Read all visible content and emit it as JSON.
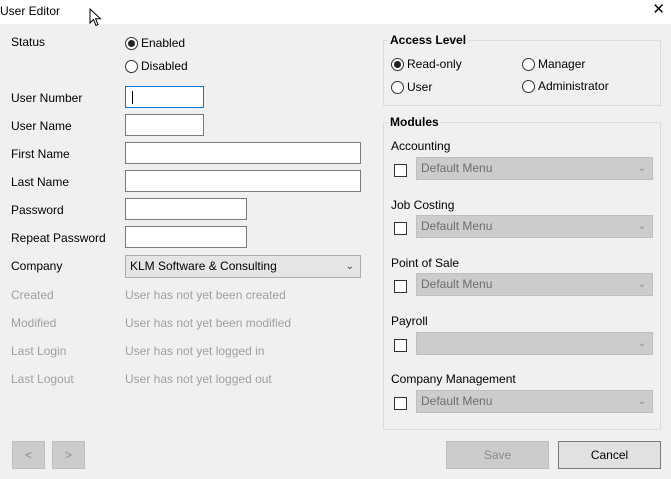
{
  "window": {
    "title": "User Editor",
    "close_glyph": "✕"
  },
  "labels": {
    "status": "Status",
    "user_number": "User Number",
    "user_name": "User Name",
    "first_name": "First Name",
    "last_name": "Last Name",
    "password": "Password",
    "repeat_password": "Repeat Password",
    "company": "Company",
    "created": "Created",
    "modified": "Modified",
    "last_login": "Last Login",
    "last_logout": "Last Logout"
  },
  "status": {
    "enabled": "Enabled",
    "disabled": "Disabled",
    "selected": "Enabled"
  },
  "fields": {
    "user_number": "",
    "user_name": "",
    "first_name": "",
    "last_name": "",
    "password": "",
    "repeat_password": ""
  },
  "company": {
    "selected": "KLM Software & Consulting"
  },
  "info": {
    "created": "User has not yet been created",
    "modified": "User has not yet been modified",
    "last_login": "User has not yet logged in",
    "last_logout": "User has not yet logged out"
  },
  "access_level": {
    "title": "Access Level",
    "read_only": "Read-only",
    "manager": "Manager",
    "user": "User",
    "administrator": "Administrator",
    "selected": "Read-only"
  },
  "modules": {
    "title": "Modules",
    "items": [
      {
        "name": "Accounting",
        "menu": "Default Menu",
        "checked": false
      },
      {
        "name": "Job Costing",
        "menu": "Default Menu",
        "checked": false
      },
      {
        "name": "Point of Sale",
        "menu": "Default Menu",
        "checked": false
      },
      {
        "name": "Payroll",
        "menu": "",
        "checked": false
      },
      {
        "name": "Company Management",
        "menu": "Default Menu",
        "checked": false
      }
    ]
  },
  "buttons": {
    "prev": "<",
    "next": ">",
    "save": "Save",
    "cancel": "Cancel"
  },
  "icons": {
    "cursor": "mouse-pointer-icon",
    "close": "close-icon",
    "dropdown": "chevron-down-icon"
  }
}
